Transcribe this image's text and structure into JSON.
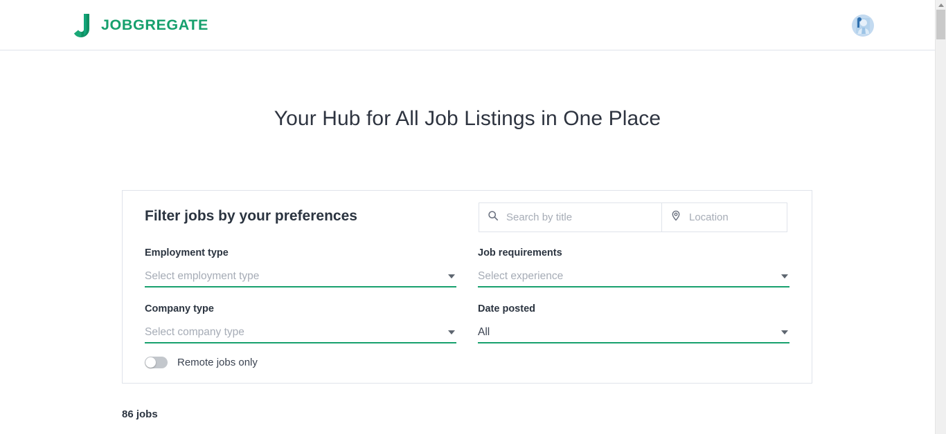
{
  "header": {
    "logo_icon": "j-letter-logo-icon",
    "brand_name": "JOBGREGATE",
    "brand_color": "#16a06d",
    "avatar_icon": "user-avatar"
  },
  "hero": {
    "title": "Your Hub for All Job Listings in One Place"
  },
  "filter_card": {
    "title": "Filter jobs by your preferences",
    "search": {
      "title_input": {
        "icon": "search-icon",
        "value": "",
        "placeholder": "Search by title"
      },
      "location_input": {
        "icon": "location-pin-icon",
        "value": "",
        "placeholder": "Location"
      }
    },
    "fields": [
      {
        "label": "Employment type",
        "value": "Select employment type",
        "is_placeholder": true,
        "caret_icon": "chevron-down-icon"
      },
      {
        "label": "Job requirements",
        "value": "Select experience",
        "is_placeholder": true,
        "caret_icon": "chevron-down-icon"
      },
      {
        "label": "Company type",
        "value": "Select company type",
        "is_placeholder": true,
        "caret_icon": "chevron-down-icon"
      },
      {
        "label": "Date posted",
        "value": "All",
        "is_placeholder": false,
        "caret_icon": "chevron-down-icon"
      }
    ],
    "remote_toggle": {
      "label": "Remote jobs only",
      "state": "off"
    },
    "accent_color": "#16a06d"
  },
  "results": {
    "count_label": "86 jobs"
  },
  "scrollbar": {
    "up_arrow_icon": "scroll-up-arrow-icon",
    "thumb": "scrollbar-thumb"
  }
}
